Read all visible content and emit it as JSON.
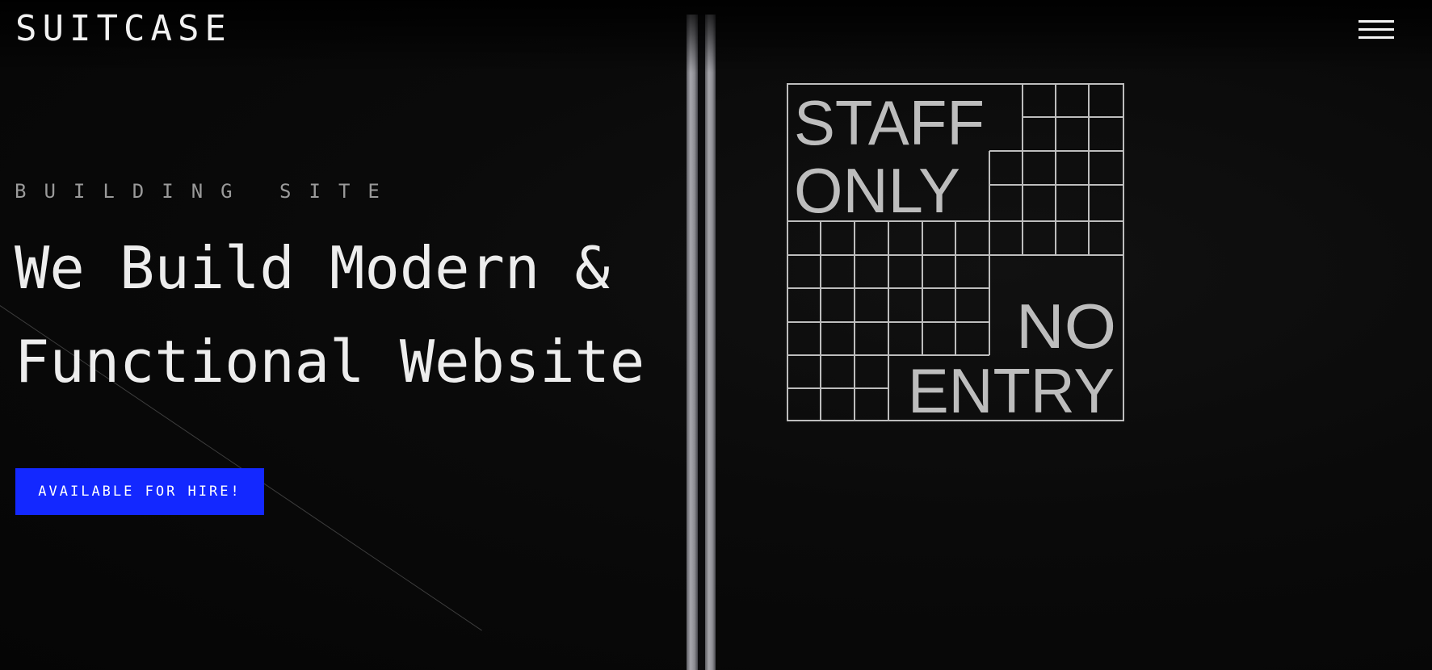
{
  "header": {
    "logo": "SUITCASE",
    "menu_icon": "hamburger-menu-icon"
  },
  "hero": {
    "eyebrow": "BUILDING SITE",
    "headline_line1": "We Build Modern &",
    "headline_line2": "Functional Website",
    "cta_label": "AVAILABLE FOR HIRE!"
  },
  "background_sign": {
    "line1": "STAFF",
    "line2": "ONLY",
    "line3": "NO",
    "line4": "ENTRY"
  },
  "colors": {
    "accent": "#1328ff",
    "background": "#080808",
    "text": "#ededed",
    "muted": "#9a9a9a"
  }
}
